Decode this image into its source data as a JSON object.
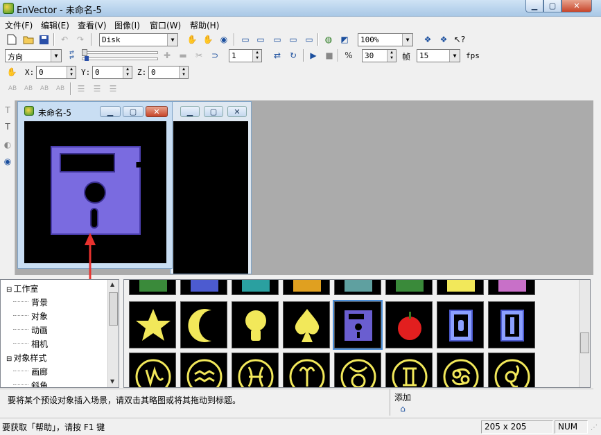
{
  "window": {
    "title": "EnVector - 未命名-5"
  },
  "menu": [
    "文件(F)",
    "编辑(E)",
    "查看(V)",
    "图像(I)",
    "窗口(W)",
    "帮助(H)"
  ],
  "toolbar1": {
    "font": "Disk",
    "zoom": "100%"
  },
  "toolbar2": {
    "direction": "方向",
    "frame": "1",
    "fps_value": "30",
    "frame_label": "帧",
    "frame_count": "15",
    "fps_label": "fps"
  },
  "toolbar3": {
    "x_label": "X:",
    "x": "0",
    "y_label": "Y:",
    "y": "0",
    "z_label": "Z:",
    "z": "0"
  },
  "toolbar4": {
    "labels": [
      "AB",
      "AB",
      "AB",
      "AB"
    ]
  },
  "child": {
    "title": "未命名-5"
  },
  "tree": {
    "items": [
      {
        "label": "工作室",
        "level": 0,
        "expander": "⊟"
      },
      {
        "label": "背景",
        "level": 1
      },
      {
        "label": "对象",
        "level": 1
      },
      {
        "label": "动画",
        "level": 1
      },
      {
        "label": "相机",
        "level": 1
      },
      {
        "label": "对象样式",
        "level": 0,
        "expander": "⊟"
      },
      {
        "label": "画廊",
        "level": 1
      },
      {
        "label": "斜角",
        "level": 1
      }
    ]
  },
  "gallery": {
    "row2": [
      "star",
      "crescent-moon",
      "light-bulb",
      "spade",
      "floppy-disk",
      "apple",
      "phone-sign",
      "wrench-sign"
    ],
    "row3": [
      "capricorn",
      "aquarius",
      "pisces",
      "aries",
      "taurus",
      "gemini",
      "cancer",
      "leo"
    ],
    "selected_index": 4
  },
  "hint": {
    "text": "要将某个预设对象插入场景，请双击其略图或将其拖动到标题。",
    "add_label": "添加"
  },
  "status": {
    "help": "要获取「帮助」，请按 F1 键",
    "size": "205 x 205",
    "num": "NUM"
  },
  "colors": {
    "floppy": "#7a6be0",
    "icon_yellow": "#f2e85a",
    "arrow": "#e8322e",
    "selection": "#4a8ed8"
  }
}
